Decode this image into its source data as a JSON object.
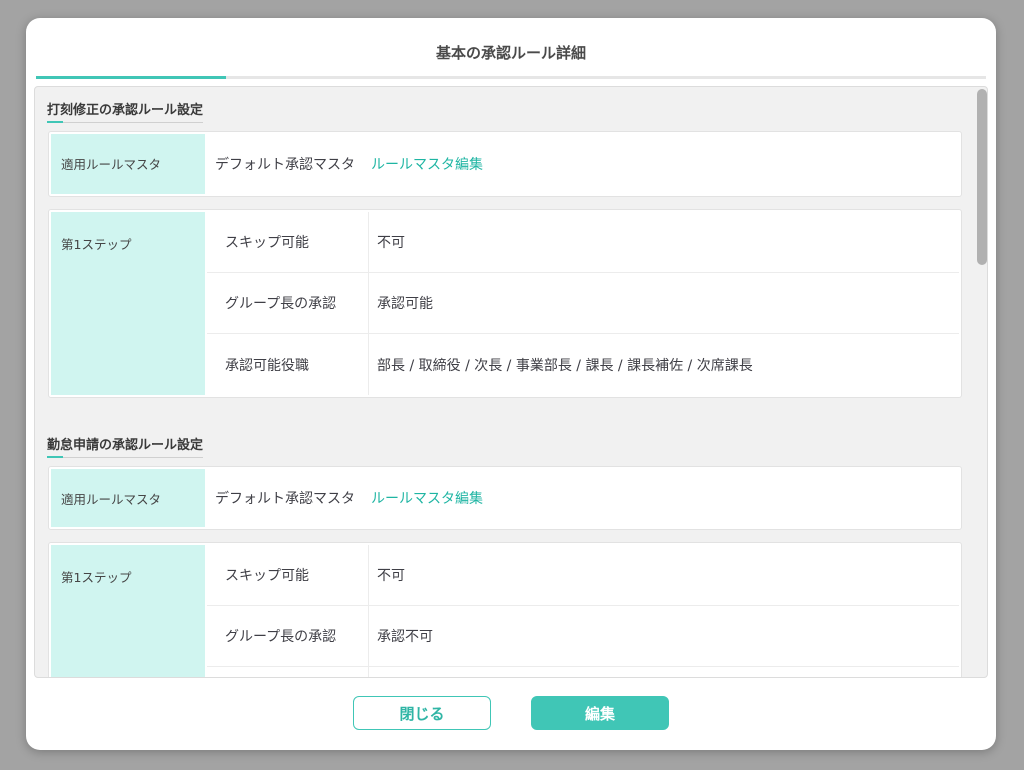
{
  "modal": {
    "title": "基本の承認ルール詳細",
    "progress": 0.2,
    "colors": {
      "accent": "#40c6b6",
      "label_bg": "#d0f5f0",
      "link": "#1fb5a3"
    }
  },
  "sections": [
    {
      "title": "打刻修正の承認ルール設定",
      "master_label": "適用ルールマスタ",
      "master_name": "デフォルト承認マスタ",
      "master_link": "ルールマスタ編集",
      "step_label": "第1ステップ",
      "rows": [
        {
          "key": "スキップ可能",
          "value": "不可"
        },
        {
          "key": "グループ長の承認",
          "value": "承認可能"
        },
        {
          "key": "承認可能役職",
          "value": "部長 / 取締役 / 次長 / 事業部長 / 課長 / 課長補佐 / 次席課長"
        }
      ]
    },
    {
      "title": "勤怠申請の承認ルール設定",
      "master_label": "適用ルールマスタ",
      "master_name": "デフォルト承認マスタ",
      "master_link": "ルールマスタ編集",
      "step_label": "第1ステップ",
      "rows": [
        {
          "key": "スキップ可能",
          "value": "不可"
        },
        {
          "key": "グループ長の承認",
          "value": "承認不可"
        },
        {
          "key": "",
          "value": ""
        }
      ]
    }
  ],
  "buttons": {
    "close": "閉じる",
    "edit": "編集"
  },
  "scrollbar": {
    "position": 0.0
  }
}
